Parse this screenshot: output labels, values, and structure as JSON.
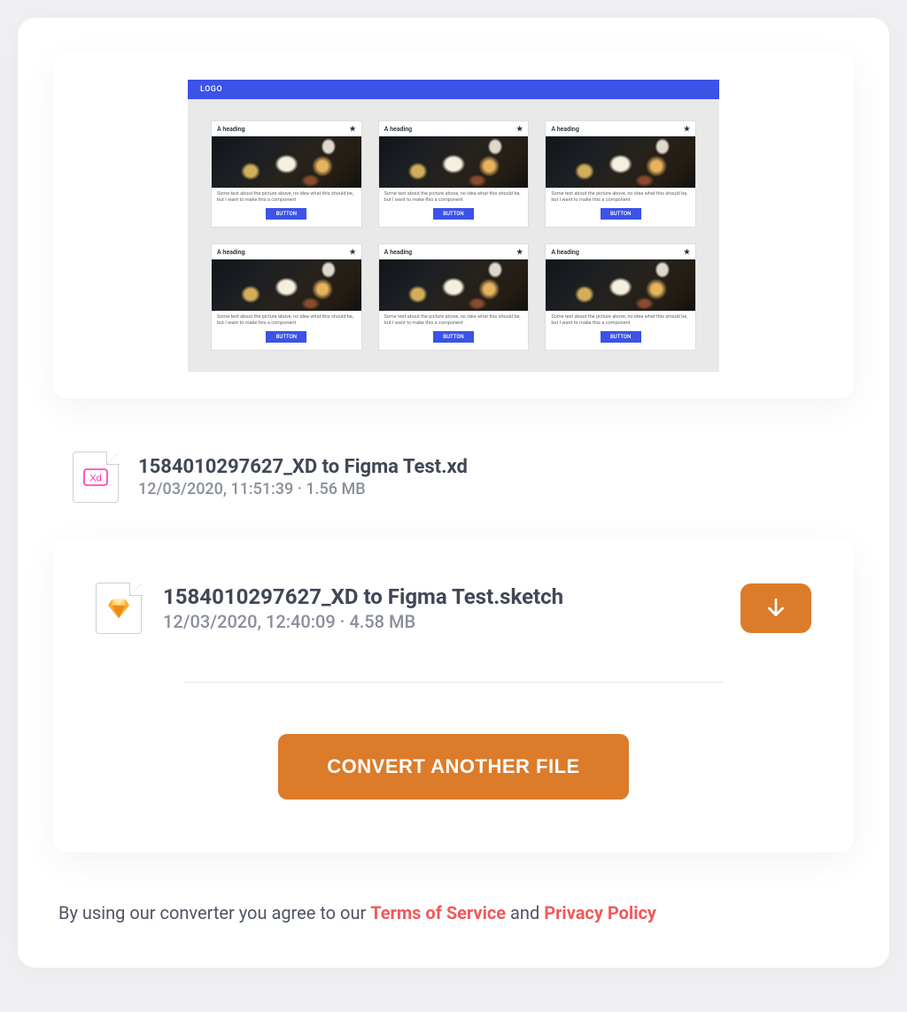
{
  "preview": {
    "logo_text": "LOGO",
    "card": {
      "heading": "A heading",
      "star": "★",
      "description": "Some text about the picture above, no idea what this should be, but I want to make this a component",
      "button_label": "BUTTON"
    }
  },
  "source_file": {
    "name": "1584010297627_XD to Figma Test.xd",
    "date": "12/03/2020, 11:51:39",
    "sep": " · ",
    "size": "1.56 MB",
    "badge": "Xd"
  },
  "result_file": {
    "name": "1584010297627_XD to Figma Test.sketch",
    "date": "12/03/2020, 12:40:09",
    "sep": " · ",
    "size": "4.58 MB"
  },
  "actions": {
    "convert_label": "CONVERT ANOTHER FILE"
  },
  "footer": {
    "prefix": "By using our converter you agree to our ",
    "tos": "Terms of Service",
    "mid": " and ",
    "privacy": "Privacy Policy"
  }
}
